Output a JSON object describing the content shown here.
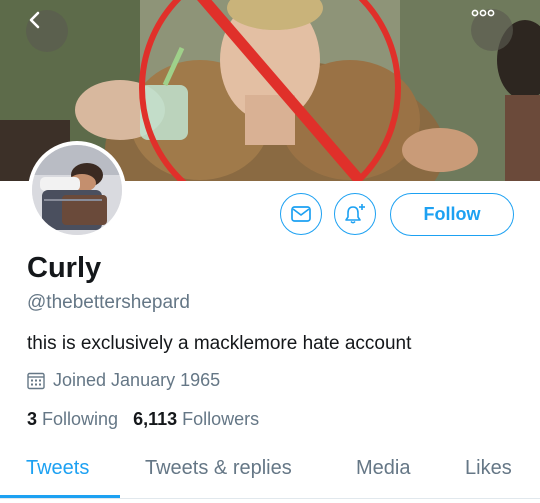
{
  "profile": {
    "display_name": "Curly",
    "handle": "@thebettershepard",
    "bio": "this is exclusively a macklemore hate account",
    "joined": "Joined January 1965"
  },
  "actions": {
    "follow_label": "Follow",
    "back_icon": "chevron-left-icon",
    "more_icon": "more-horizontal-icon",
    "mail_icon": "envelope-icon",
    "bell_icon": "bell-plus-icon"
  },
  "stats": {
    "following_count": "3",
    "following_label": "Following",
    "followers_count": "6,113",
    "followers_label": "Followers"
  },
  "tabs": [
    {
      "label": "Tweets",
      "active": true
    },
    {
      "label": "Tweets & replies",
      "active": false
    },
    {
      "label": "Media",
      "active": false
    },
    {
      "label": "Likes",
      "active": false
    }
  ],
  "colors": {
    "accent": "#1da1f2",
    "secondary_text": "#657786",
    "primary_text": "#14171a",
    "prohibition_red": "#e0302a"
  }
}
